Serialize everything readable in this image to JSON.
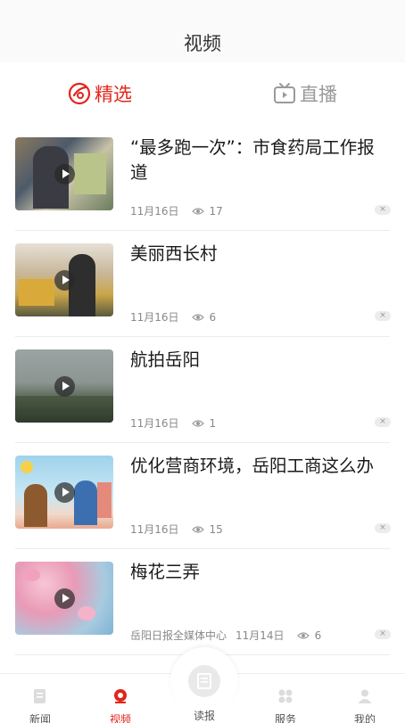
{
  "header": {
    "title": "视频"
  },
  "tabs": [
    {
      "label": "精选",
      "icon": "featured-icon",
      "active": true
    },
    {
      "label": "直播",
      "icon": "tv-icon",
      "active": false
    }
  ],
  "items": [
    {
      "title": "“最多跑一次”：市食药局工作报道",
      "date": "11月16日",
      "views": "17",
      "source": ""
    },
    {
      "title": "美丽西长村",
      "date": "11月16日",
      "views": "6",
      "source": ""
    },
    {
      "title": "航拍岳阳",
      "date": "11月16日",
      "views": "1",
      "source": ""
    },
    {
      "title": "优化营商环境，岳阳工商这么办",
      "date": "11月16日",
      "views": "15",
      "source": ""
    },
    {
      "title": "梅花三弄",
      "date": "11月14日",
      "views": "6",
      "source": "岳阳日报全媒体中心"
    }
  ],
  "bottom_nav": [
    {
      "label": "新闻",
      "icon": "news-icon"
    },
    {
      "label": "视频",
      "icon": "video-icon"
    },
    {
      "label": "读报",
      "icon": "newspaper-icon"
    },
    {
      "label": "服务",
      "icon": "services-icon"
    },
    {
      "label": "我的",
      "icon": "profile-icon"
    }
  ],
  "colors": {
    "accent": "#e1251b",
    "inactive": "#9a9a9a"
  }
}
